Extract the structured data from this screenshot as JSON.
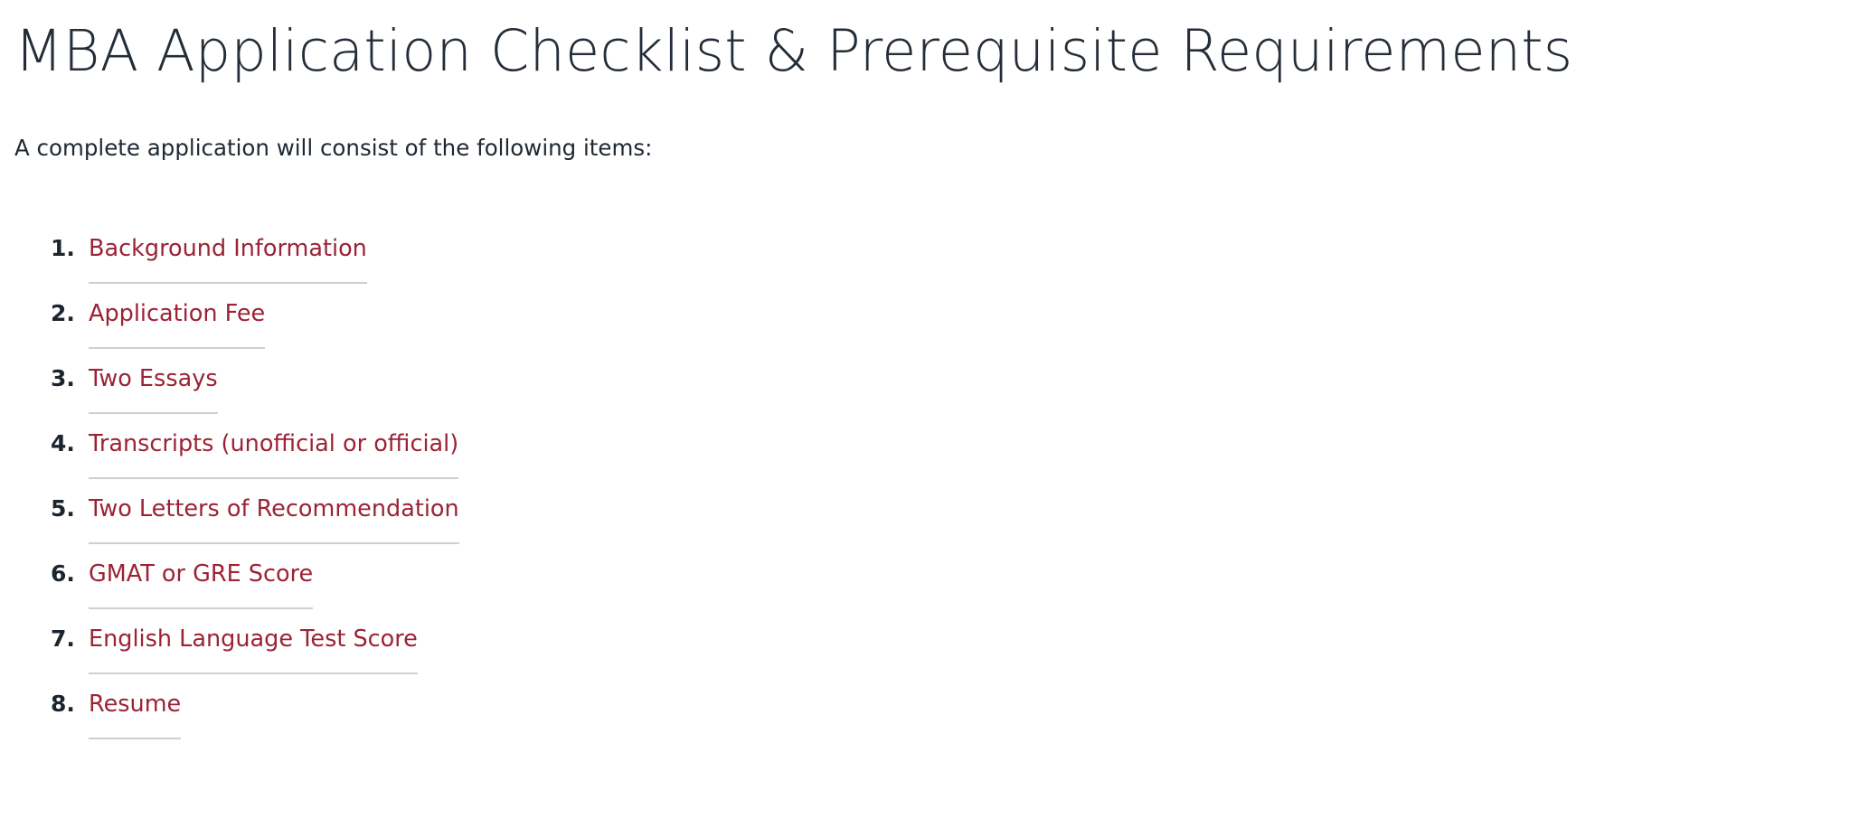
{
  "page": {
    "background_color": "#ffffff",
    "title": "MBA Application Checklist & Prerequisite Requirements",
    "intro": "A complete application will consist of the following items:"
  },
  "theme": {
    "title_color": "#242d38",
    "body_text_color": "#1f2833",
    "link_color": "#9b2335",
    "link_underline_color": "#cfcfcf",
    "number_color": "#1c252f"
  },
  "checklist": {
    "items": [
      {
        "number": "1.",
        "label": "Background Information"
      },
      {
        "number": "2.",
        "label": "Application Fee"
      },
      {
        "number": "3.",
        "label": "Two Essays"
      },
      {
        "number": "4.",
        "label": "Transcripts (unofficial or official)"
      },
      {
        "number": "5.",
        "label": "Two Letters of Recommendation"
      },
      {
        "number": "6.",
        "label": "GMAT or GRE Score"
      },
      {
        "number": "7.",
        "label": "English Language Test Score"
      },
      {
        "number": "8.",
        "label": "Resume"
      }
    ]
  }
}
